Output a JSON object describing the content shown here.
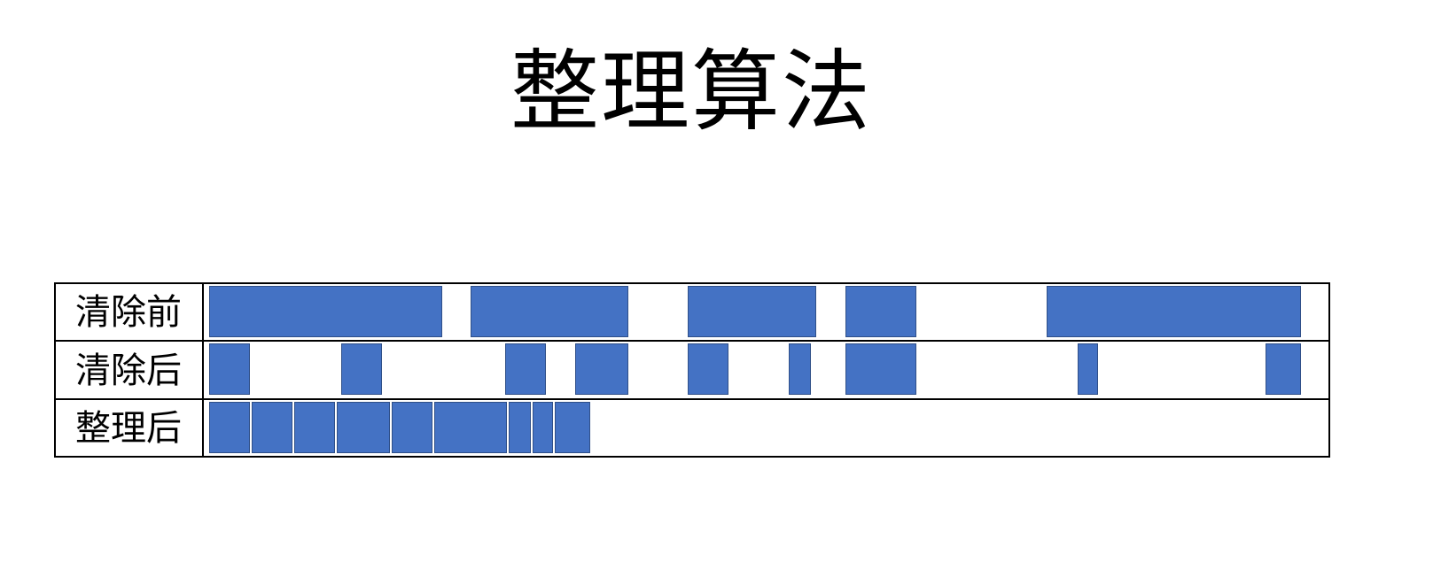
{
  "title": "整理算法",
  "colors": {
    "block_fill": "#4472c4",
    "block_border": "#2f4f88",
    "grid_line": "#000000"
  },
  "rows": [
    {
      "key": "before",
      "label": "清除前",
      "blocks": [
        {
          "start": 0,
          "end": 263
        },
        {
          "start": 295,
          "end": 473
        },
        {
          "start": 540,
          "end": 685
        },
        {
          "start": 718,
          "end": 798
        },
        {
          "start": 945,
          "end": 1232
        }
      ]
    },
    {
      "key": "after-sweep",
      "label": "清除后",
      "blocks": [
        {
          "start": 0,
          "end": 46
        },
        {
          "start": 149,
          "end": 195
        },
        {
          "start": 334,
          "end": 380
        },
        {
          "start": 413,
          "end": 473
        },
        {
          "start": 540,
          "end": 586
        },
        {
          "start": 654,
          "end": 679
        },
        {
          "start": 718,
          "end": 798
        },
        {
          "start": 980,
          "end": 1003
        },
        {
          "start": 1192,
          "end": 1232
        }
      ]
    },
    {
      "key": "after-compact",
      "label": "整理后",
      "blocks": [
        {
          "start": 0,
          "end": 46
        },
        {
          "start": 48,
          "end": 94
        },
        {
          "start": 96,
          "end": 142
        },
        {
          "start": 144,
          "end": 204
        },
        {
          "start": 206,
          "end": 252
        },
        {
          "start": 254,
          "end": 336
        },
        {
          "start": 338,
          "end": 363
        },
        {
          "start": 365,
          "end": 388
        },
        {
          "start": 390,
          "end": 430
        }
      ]
    }
  ]
}
